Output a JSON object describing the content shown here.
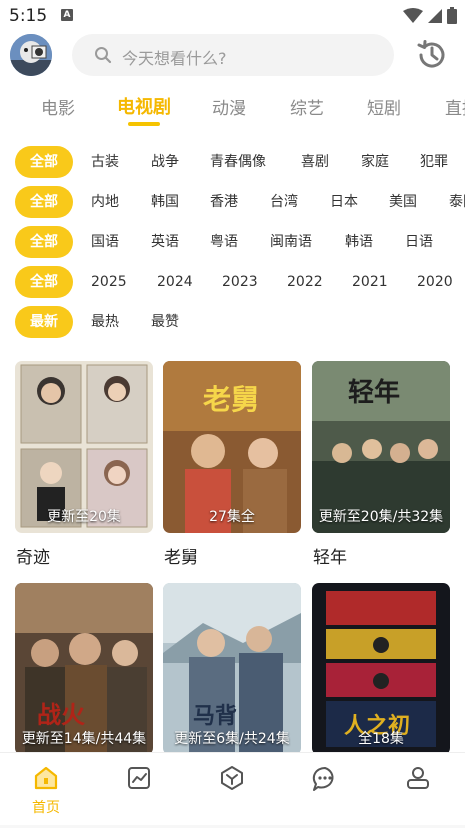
{
  "status": {
    "time": "5:15",
    "indicator": "A"
  },
  "header": {
    "search_placeholder": "今天想看什么?"
  },
  "tabs": [
    {
      "label": "电影",
      "active": false
    },
    {
      "label": "电视剧",
      "active": true
    },
    {
      "label": "动漫",
      "active": false
    },
    {
      "label": "综艺",
      "active": false
    },
    {
      "label": "短剧",
      "active": false
    },
    {
      "label": "直播",
      "active": false
    }
  ],
  "filters": {
    "genre": {
      "active": "全部",
      "options": [
        "古装",
        "战争",
        "青春偶像",
        "喜剧",
        "家庭",
        "犯罪"
      ]
    },
    "region": {
      "active": "全部",
      "options": [
        "内地",
        "韩国",
        "香港",
        "台湾",
        "日本",
        "美国",
        "泰国"
      ]
    },
    "language": {
      "active": "全部",
      "options": [
        "国语",
        "英语",
        "粤语",
        "闽南语",
        "韩语",
        "日语"
      ]
    },
    "year": {
      "active": "全部",
      "options": [
        "2025",
        "2024",
        "2023",
        "2022",
        "2021",
        "2020"
      ]
    },
    "sort": {
      "active": "最新",
      "options": [
        "最热",
        "最赞"
      ]
    }
  },
  "cards": [
    {
      "title": "奇迹",
      "badge": "更新至20集"
    },
    {
      "title": "老舅",
      "badge": "27集全"
    },
    {
      "title": "轻年",
      "badge": "更新至20集/共32集"
    },
    {
      "title": "",
      "badge": "更新至14集/共44集"
    },
    {
      "title": "",
      "badge": "更新至6集/共24集"
    },
    {
      "title": "",
      "badge": "全18集"
    }
  ],
  "bottom_nav": {
    "home_label": "首页"
  },
  "colors": {
    "accent": "#f5b800",
    "chip_active": "#f9c91a"
  }
}
